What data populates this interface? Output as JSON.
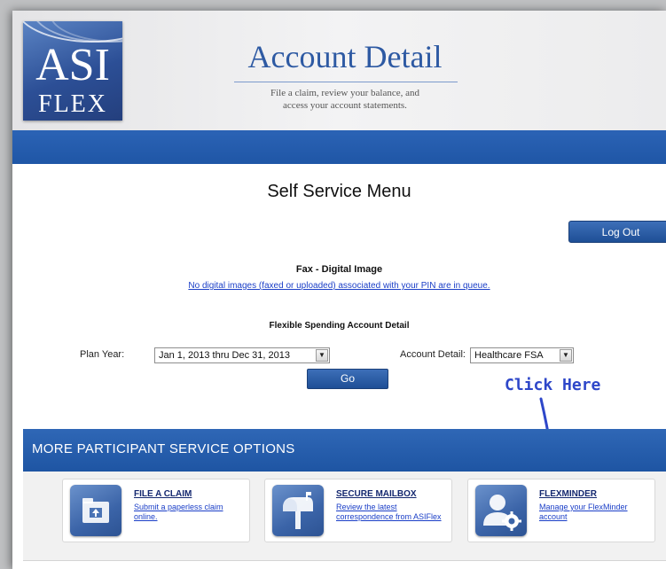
{
  "brand": {
    "logo_top": "ASI",
    "logo_bottom": "FLEX"
  },
  "header": {
    "title": "Account Detail",
    "subtitle_line1": "File a claim, review your balance, and",
    "subtitle_line2": "access your account statements."
  },
  "menu": {
    "title": "Self Service Menu",
    "logout_label": "Log Out"
  },
  "fax": {
    "title": "Fax - Digital Image",
    "link": "No digital images (faxed or uploaded) associated with your PIN are in queue."
  },
  "fsa": {
    "title": "Flexible Spending Account Detail",
    "plan_year_label": "Plan Year:",
    "plan_year_value": "Jan 1, 2013 thru Dec 31, 2013",
    "account_detail_label": "Account Detail:",
    "account_detail_value": "Healthcare FSA",
    "go_label": "Go"
  },
  "annotation": {
    "text": "Click Here",
    "color": "#2e47c9"
  },
  "options": {
    "title": "MORE PARTICIPANT SERVICE OPTIONS",
    "cards": [
      {
        "title": "FILE A CLAIM",
        "desc": "Submit a paperless claim online.",
        "icon": "folder-upload-icon"
      },
      {
        "title": "SECURE MAILBOX",
        "desc": "Review the latest correspondence from ASIFlex",
        "icon": "mailbox-icon"
      },
      {
        "title": "FLEXMINDER",
        "desc": "Manage your FlexMinder account",
        "icon": "user-settings-icon"
      }
    ]
  },
  "colors": {
    "accent": "#1f56a6",
    "link": "#1a3ec7",
    "title": "#2e5aa3"
  }
}
